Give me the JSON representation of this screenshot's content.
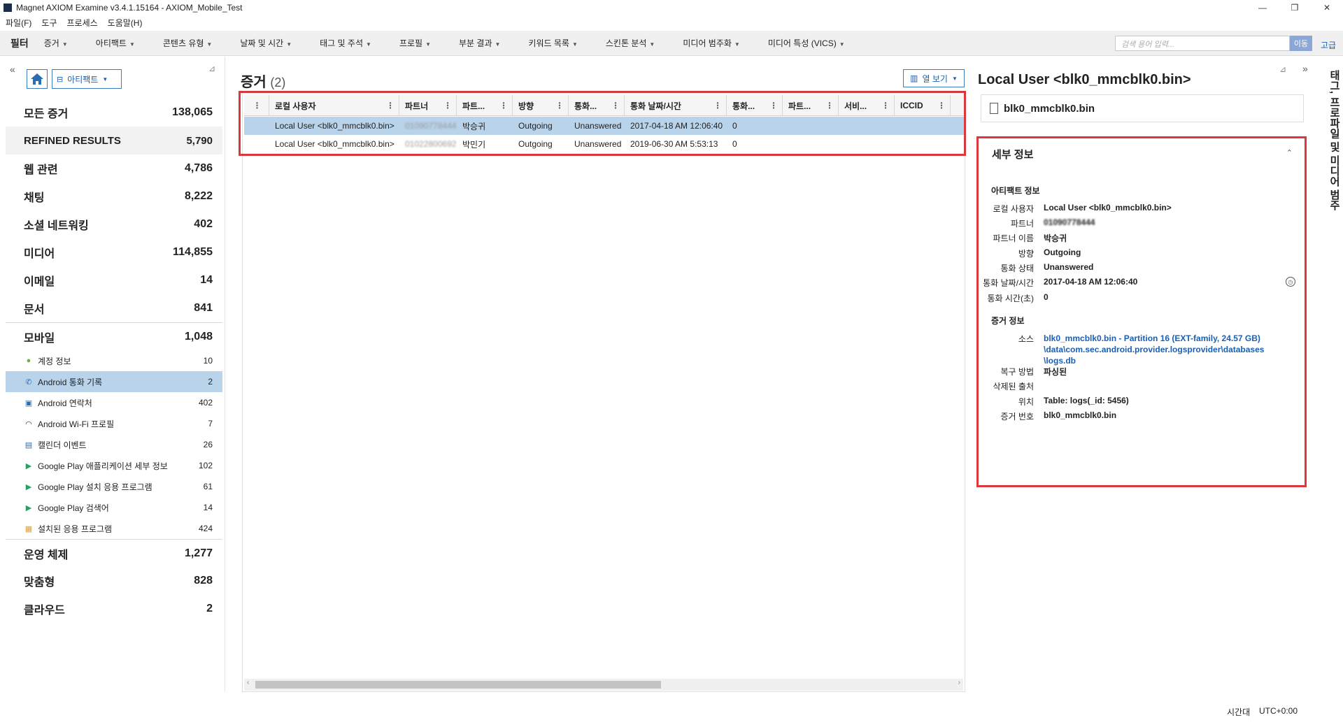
{
  "window": {
    "title": "Magnet AXIOM Examine v3.4.1.15164 - AXIOM_Mobile_Test",
    "controls": [
      "—",
      "❐",
      "✕"
    ]
  },
  "menu": [
    "파일(F)",
    "도구",
    "프로세스",
    "도움말(H)"
  ],
  "filterbar": {
    "label": "필터",
    "dropdowns": [
      "증거",
      "아티팩트",
      "콘텐츠 유형",
      "날짜 및 시간",
      "태그 및 주석",
      "프로필",
      "부분 결과",
      "키워드 목록",
      "스킨톤 분석",
      "미디어 범주화",
      "미디어 특성 (VICS)"
    ],
    "search_placeholder": "검색 용어 입력...",
    "search_button": "이동",
    "advanced": "고급"
  },
  "left": {
    "view_label": "아티팩트",
    "categories_top": [
      {
        "label": "모든 증거",
        "count": "138,065"
      },
      {
        "label": "REFINED RESULTS",
        "count": "5,790"
      },
      {
        "label": "웹 관련",
        "count": "4,786"
      },
      {
        "label": "채팅",
        "count": "8,222"
      },
      {
        "label": "소셜 네트워킹",
        "count": "402"
      },
      {
        "label": "미디어",
        "count": "114,855"
      },
      {
        "label": "이메일",
        "count": "14"
      },
      {
        "label": "문서",
        "count": "841"
      },
      {
        "label": "모바일",
        "count": "1,048"
      }
    ],
    "sub_items": [
      {
        "label": "계정 정보",
        "count": "10",
        "icon": "user-icon"
      },
      {
        "label": "Android 통화 기록",
        "count": "2",
        "icon": "phone-icon"
      },
      {
        "label": "Android 연락처",
        "count": "402",
        "icon": "contacts-icon"
      },
      {
        "label": "Android Wi-Fi 프로필",
        "count": "7",
        "icon": "wifi-icon"
      },
      {
        "label": "캘린더 이벤트",
        "count": "26",
        "icon": "calendar-icon"
      },
      {
        "label": "Google Play 애플리케이션 세부 정보",
        "count": "102",
        "icon": "play-icon"
      },
      {
        "label": "Google Play 설치 응용 프로그램",
        "count": "61",
        "icon": "play-icon"
      },
      {
        "label": "Google Play 검색어",
        "count": "14",
        "icon": "play-icon"
      },
      {
        "label": "설치된 응용 프로그램",
        "count": "424",
        "icon": "apps-icon"
      }
    ],
    "categories_bottom": [
      {
        "label": "운영 체제",
        "count": "1,277"
      },
      {
        "label": "맞춤형",
        "count": "828"
      },
      {
        "label": "클라우드",
        "count": "2"
      }
    ]
  },
  "center": {
    "title": "증거",
    "count": "(2)",
    "column_view": "열 보기",
    "columns": [
      "로컬 사용자",
      "파트너",
      "파트...",
      "방향",
      "통화...",
      "통화 날짜/시간",
      "통화...",
      "파트...",
      "서비...",
      "ICCID"
    ],
    "rows": [
      [
        "Local User <blk0_mmcblk0.bin>",
        "01090778444",
        "박승귀",
        "Outgoing",
        "Unanswered",
        "2017-04-18 AM 12:06:40",
        "0",
        "",
        "",
        ""
      ],
      [
        "Local User <blk0_mmcblk0.bin>",
        "01022800692",
        "박민기",
        "Outgoing",
        "Unanswered",
        "2019-06-30 AM 5:53:13",
        "0",
        "",
        "",
        ""
      ]
    ]
  },
  "right": {
    "title": "Local User <blk0_mmcblk0.bin>",
    "file": "blk0_mmcblk0.bin",
    "detail_title": "세부 정보",
    "artifact_section": "아티팩트 정보",
    "artifact_fields": [
      {
        "label": "로컬 사용자",
        "value": "Local User <blk0_mmcblk0.bin>"
      },
      {
        "label": "파트너",
        "value": "01090778444"
      },
      {
        "label": "파트너 이름",
        "value": "박승귀"
      },
      {
        "label": "방향",
        "value": "Outgoing"
      },
      {
        "label": "통화 상태",
        "value": "Unanswered"
      },
      {
        "label": "통화 날짜/시간",
        "value": "2017-04-18 AM 12:06:40"
      },
      {
        "label": "통화 시간(초)",
        "value": "0"
      }
    ],
    "evidence_section": "증거 정보",
    "source_label": "소스",
    "source_lines": [
      "blk0_mmcblk0.bin - Partition 16 (EXT-family, 24.57 GB)",
      "\\data\\com.sec.android.provider.logsprovider\\databases",
      "\\logs.db"
    ],
    "evidence_fields": [
      {
        "label": "복구 방법",
        "value": "파싱된"
      },
      {
        "label": "삭제된 출처",
        "value": ""
      },
      {
        "label": "위치",
        "value": "Table: logs(_id: 5456)"
      },
      {
        "label": "증거 번호",
        "value": "blk0_mmcblk0.bin"
      }
    ],
    "side_tab": "태그, 프로파일 및 미디어 범주"
  },
  "status": {
    "label": "시간대",
    "value": "UTC+0:00"
  }
}
